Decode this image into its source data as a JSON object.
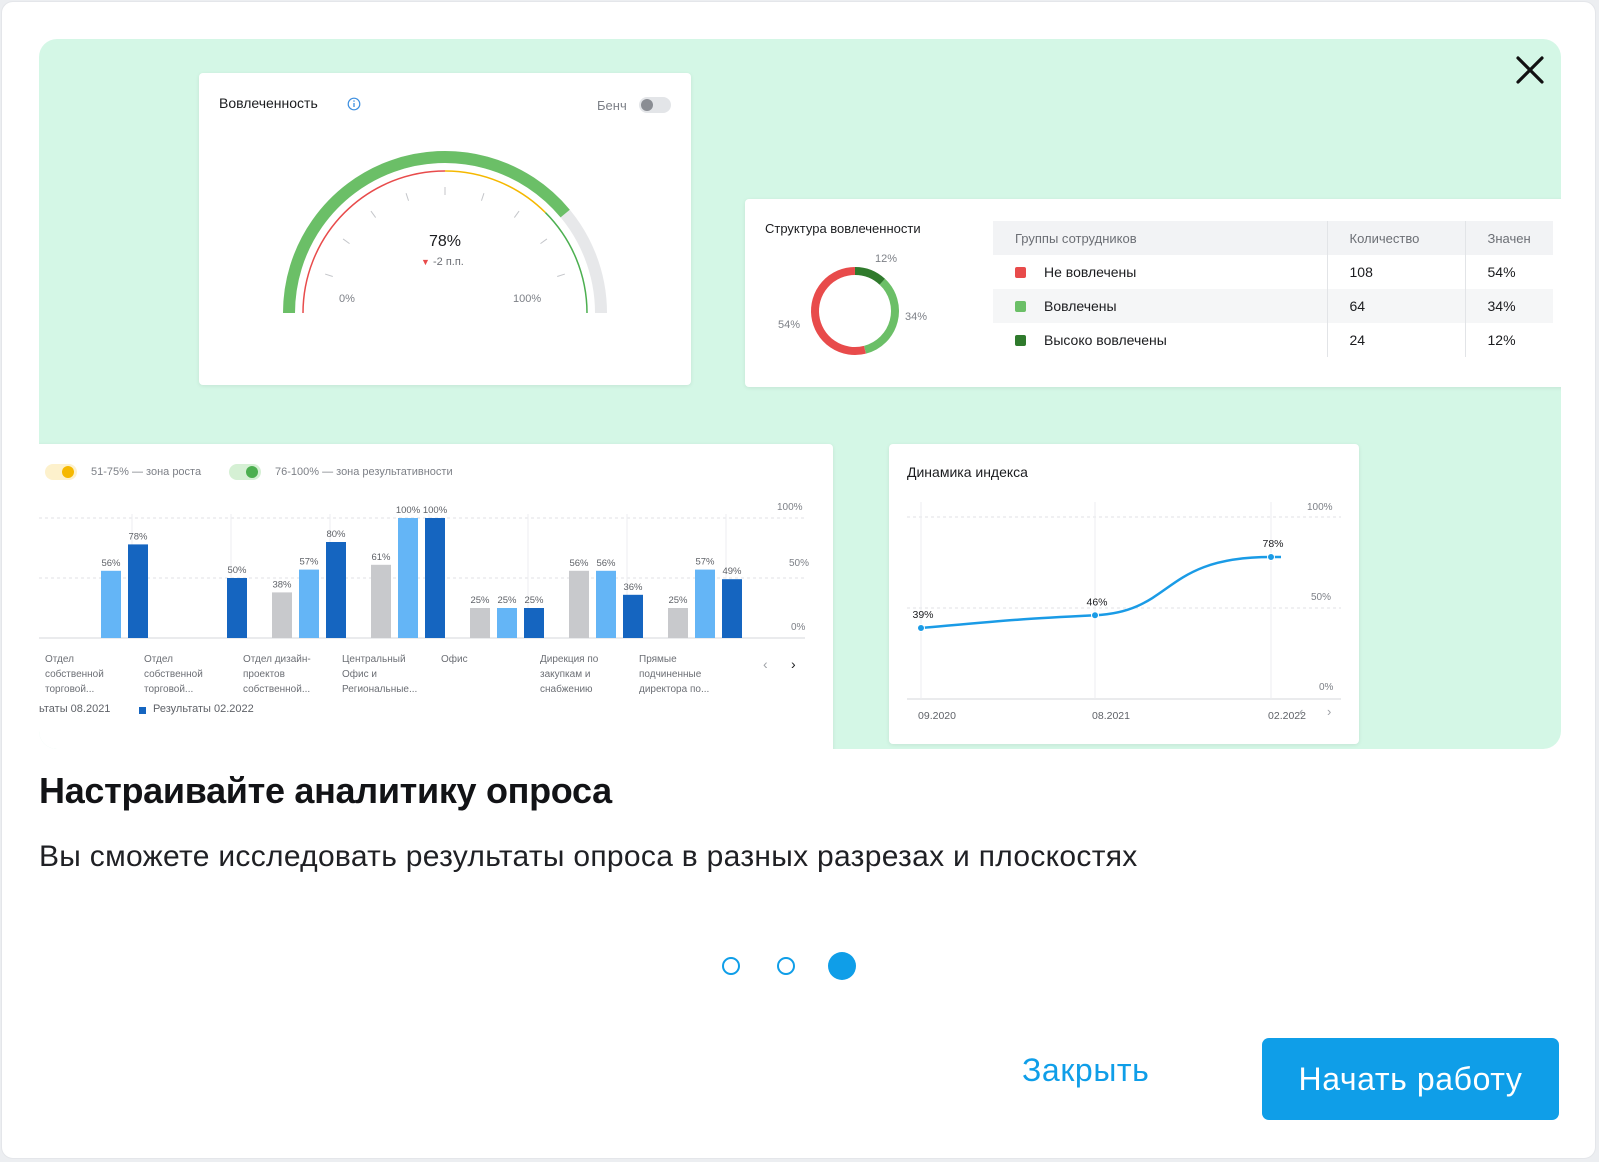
{
  "hero": {
    "gauge_card": {
      "title": "Вовлеченность",
      "bench_label": "Бенч",
      "value": "78%",
      "delta": "-2 п.п.",
      "min_label": "0%",
      "max_label": "100%",
      "value_fraction": 0.78
    },
    "structure_card": {
      "title": "Структура вовлеченности",
      "donut_labels": {
        "high": "12%",
        "engaged": "34%",
        "not_engaged": "54%"
      },
      "columns": [
        "Группы сотрудников",
        "Количество",
        "Значен"
      ],
      "rows": [
        {
          "group": "Не вовлечены",
          "count": "108",
          "value": "54%",
          "color": "#e84b4b"
        },
        {
          "group": "Вовлечены",
          "count": "64",
          "value": "34%",
          "color": "#6bbf67"
        },
        {
          "group": "Высоко вовлечены",
          "count": "24",
          "value": "12%",
          "color": "#2f7a2c"
        }
      ]
    },
    "bars_card": {
      "legend_zone_growth": "51-75% — зона роста",
      "legend_zone_result": "76-100% — зона результативности",
      "legend_prev": "ьтаты 08.2021",
      "legend_curr": "Результаты 02.2022",
      "axis_labels": [
        "100%",
        "50%",
        "0%"
      ]
    },
    "line_card": {
      "title": "Динамика индекса",
      "axis_labels": [
        "100%",
        "50%",
        "0%"
      ]
    }
  },
  "chart_data": [
    {
      "type": "bar",
      "categories": [
        [
          "Отдел",
          "собственной",
          "торговой..."
        ],
        [
          "Отдел",
          "собственной",
          "торговой..."
        ],
        [
          "Отдел дизайн-",
          "проектов",
          "собственной..."
        ],
        [
          "Центральный",
          "Офис и",
          "Региональные..."
        ],
        [
          "Офис"
        ],
        [
          "Дирекция по",
          "закупкам и",
          "снабжению"
        ],
        [
          "Прямые",
          "подчиненные",
          "директора по..."
        ]
      ],
      "series": [
        {
          "name": "",
          "color": "#c8c9cc",
          "values": [
            null,
            null,
            38,
            61,
            25,
            56,
            25
          ]
        },
        {
          "name": "",
          "color": "#64b5f6",
          "values": [
            56,
            null,
            57,
            100,
            25,
            56,
            57
          ]
        },
        {
          "name": "Результаты 02.2022",
          "color": "#1565c0",
          "values": [
            78,
            50,
            80,
            100,
            25,
            36,
            49
          ]
        }
      ],
      "ylim": [
        0,
        100
      ]
    },
    {
      "type": "line",
      "x": [
        "09.2020",
        "08.2021",
        "02.2022"
      ],
      "series": [
        {
          "name": "",
          "values": [
            39,
            46,
            78
          ]
        }
      ],
      "ylim": [
        0,
        100
      ]
    },
    {
      "type": "pie",
      "slices": [
        {
          "label": "Не вовлечены",
          "value": 54,
          "color": "#e84b4b"
        },
        {
          "label": "Вовлечены",
          "value": 34,
          "color": "#6bbf67"
        },
        {
          "label": "Высоко вовлечены",
          "value": 12,
          "color": "#2f7a2c"
        }
      ]
    }
  ],
  "headline": "Настраивайте аналитику опроса",
  "subtitle": "Вы сможете исследовать результаты опроса в разных разрезах и плоскостях",
  "pager": {
    "count": 3,
    "active": 3
  },
  "buttons": {
    "close": "Закрыть",
    "start": "Начать работу"
  }
}
